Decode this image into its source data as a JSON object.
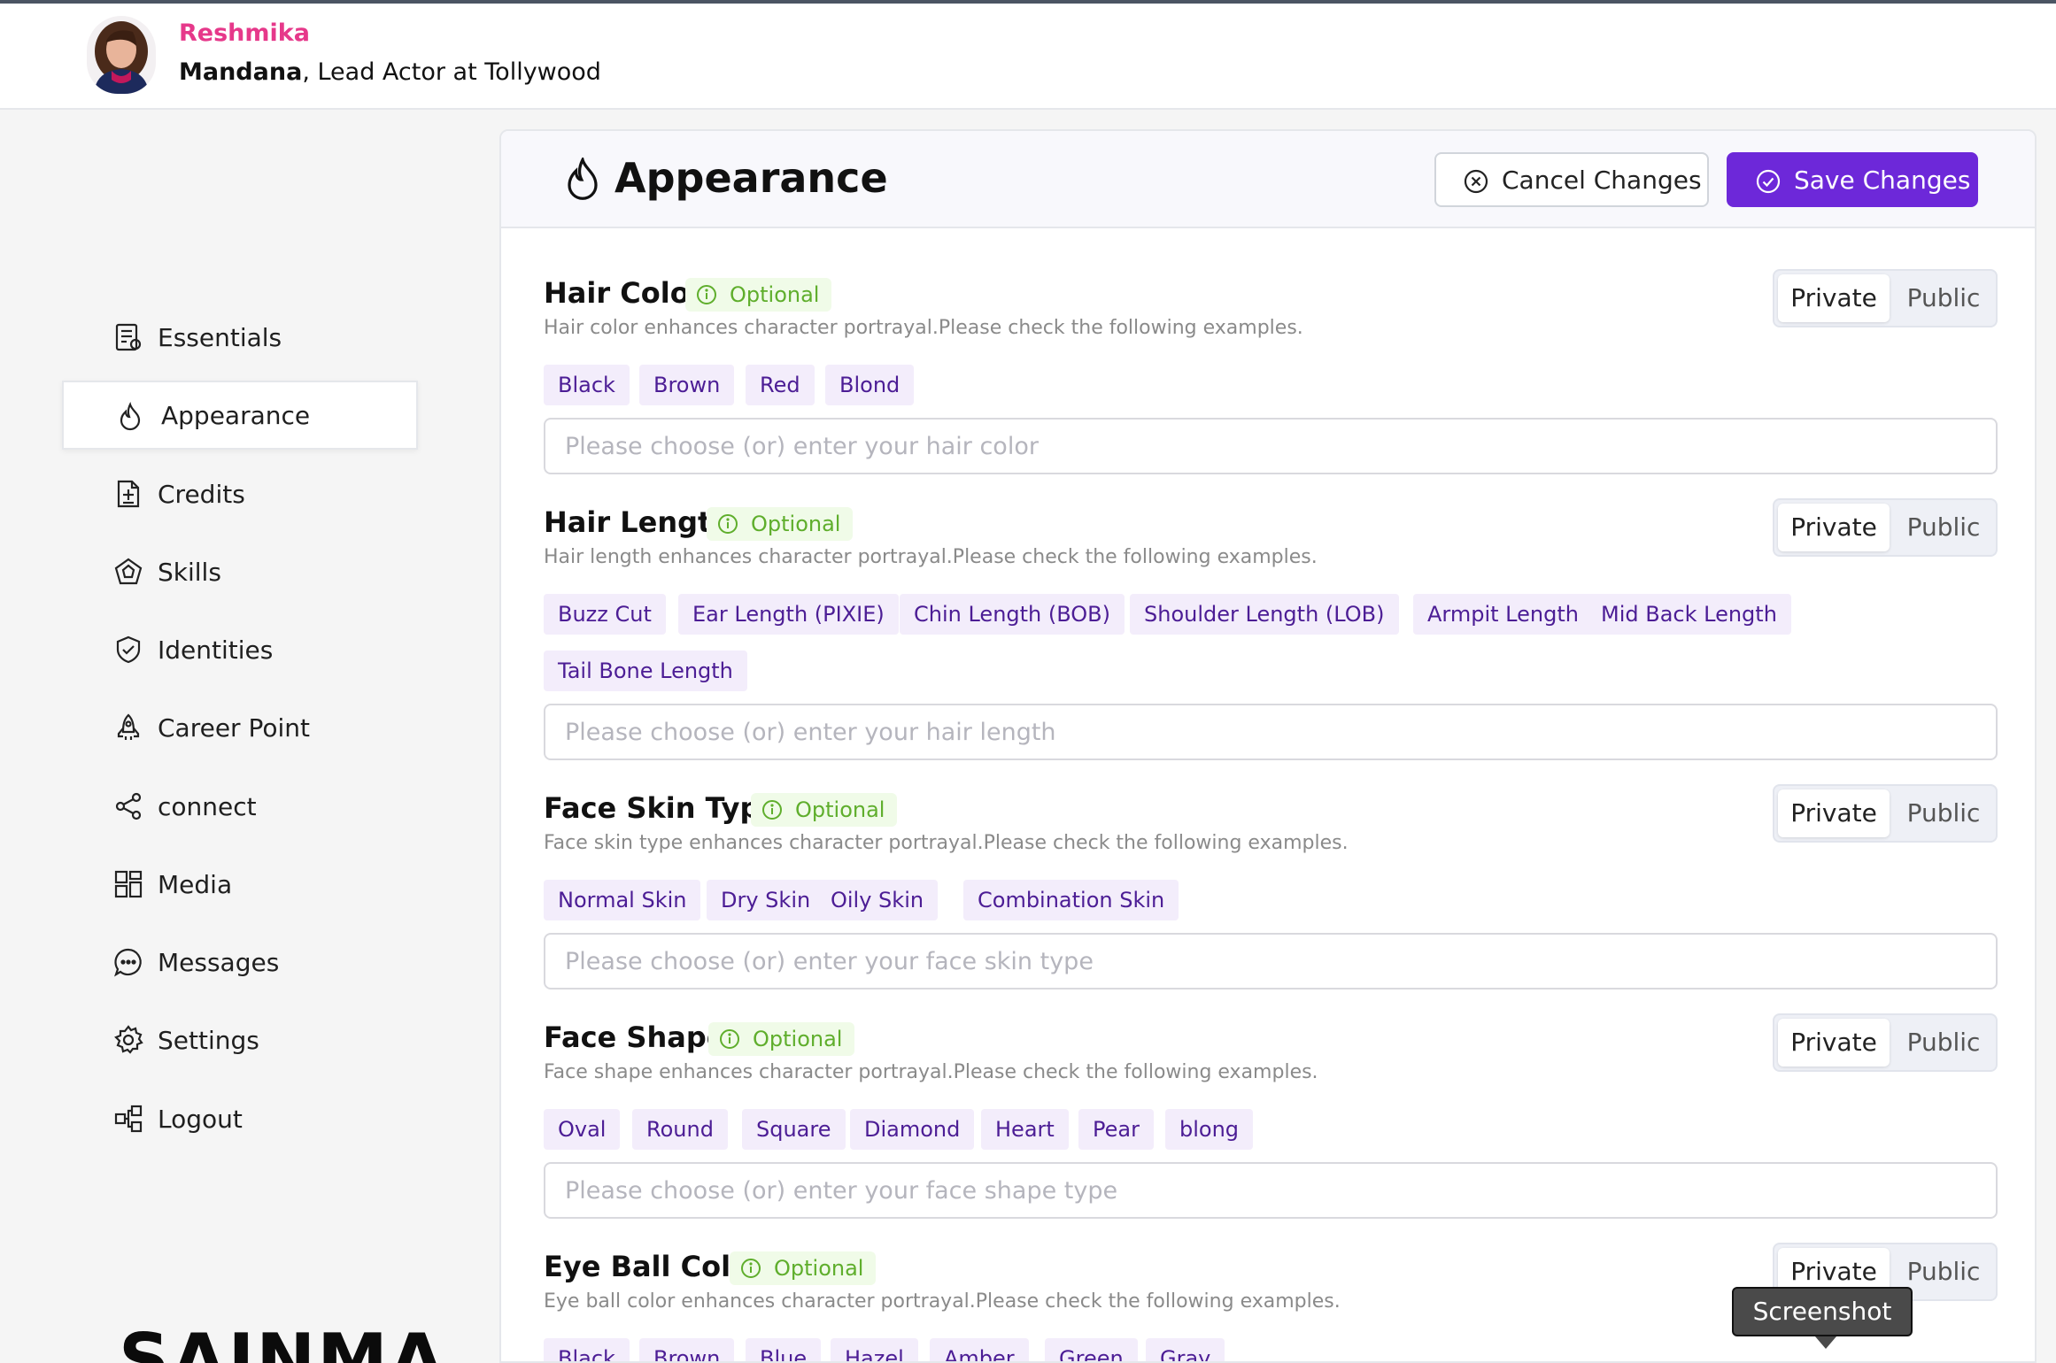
{
  "user": {
    "first_name": "Reshmika",
    "last_name": "Mandana",
    "role_suffix": ", Lead Actor at Tollywood"
  },
  "sidebar": {
    "items": [
      {
        "label": "Essentials",
        "icon": "essentials-icon",
        "active": false
      },
      {
        "label": "Appearance",
        "icon": "flame-icon",
        "active": true
      },
      {
        "label": "Credits",
        "icon": "credits-icon",
        "active": false
      },
      {
        "label": "Skills",
        "icon": "skills-icon",
        "active": false
      },
      {
        "label": "Identities",
        "icon": "shield-check-icon",
        "active": false
      },
      {
        "label": "Career Point",
        "icon": "rocket-icon",
        "active": false
      },
      {
        "label": "connect",
        "icon": "share-icon",
        "active": false
      },
      {
        "label": "Media",
        "icon": "media-grid-icon",
        "active": false
      },
      {
        "label": "Messages",
        "icon": "chat-icon",
        "active": false
      },
      {
        "label": "Settings",
        "icon": "gear-icon",
        "active": false
      },
      {
        "label": "Logout",
        "icon": "logout-icon",
        "active": false
      }
    ],
    "logo_text": "SAINMA"
  },
  "panel": {
    "title": "Appearance",
    "cancel_label": "Cancel Changes",
    "save_label": "Save Changes"
  },
  "sections": [
    {
      "title": "Hair Color",
      "optional_label": "Optional",
      "description": "Hair color enhances character portrayal.Please check the following examples.",
      "chips": [
        "Black",
        "Brown",
        "Red",
        "Blond"
      ],
      "placeholder": "Please choose (or) enter your hair color",
      "private_label": "Private",
      "public_label": "Public"
    },
    {
      "title": "Hair Length",
      "optional_label": "Optional",
      "description": "Hair length enhances character portrayal.Please check the following examples.",
      "chips": [
        "Buzz Cut",
        "Ear Length (PIXIE)",
        "Chin Length (BOB)",
        "Shoulder Length (LOB)",
        "Armpit Length",
        "Mid Back Length",
        "Tail Bone Length"
      ],
      "placeholder": "Please choose (or) enter your hair length",
      "private_label": "Private",
      "public_label": "Public"
    },
    {
      "title": "Face Skin Type",
      "optional_label": "Optional",
      "description": "Face skin type enhances character portrayal.Please check the following examples.",
      "chips": [
        "Normal Skin",
        "Dry Skin",
        "Oily Skin",
        "Combination Skin"
      ],
      "placeholder": "Please choose (or) enter your face skin type",
      "private_label": "Private",
      "public_label": "Public"
    },
    {
      "title": "Face Shape",
      "optional_label": "Optional",
      "description": "Face shape enhances character portrayal.Please check the following examples.",
      "chips": [
        "Oval",
        "Round",
        "Square",
        "Diamond",
        "Heart",
        "Pear",
        "blong"
      ],
      "placeholder": "Please choose (or) enter your face shape type",
      "private_label": "Private",
      "public_label": "Public"
    },
    {
      "title": "Eye Ball Color",
      "optional_label": "Optional",
      "description": "Eye ball color enhances character portrayal.Please check the following examples.",
      "chips": [
        "Black",
        "Brown",
        "Blue",
        "Hazel",
        "Amber",
        "Green",
        "Gray"
      ],
      "placeholder": "",
      "private_label": "Private",
      "public_label": "Public"
    }
  ],
  "tooltip": {
    "label": "Screenshot"
  },
  "colors": {
    "brand_pink": "#e6388a",
    "accent_purple": "#6d28d9",
    "chip_bg": "#f3edfb",
    "chip_text": "#4c1d95",
    "optional_green": "#5fae2c"
  }
}
